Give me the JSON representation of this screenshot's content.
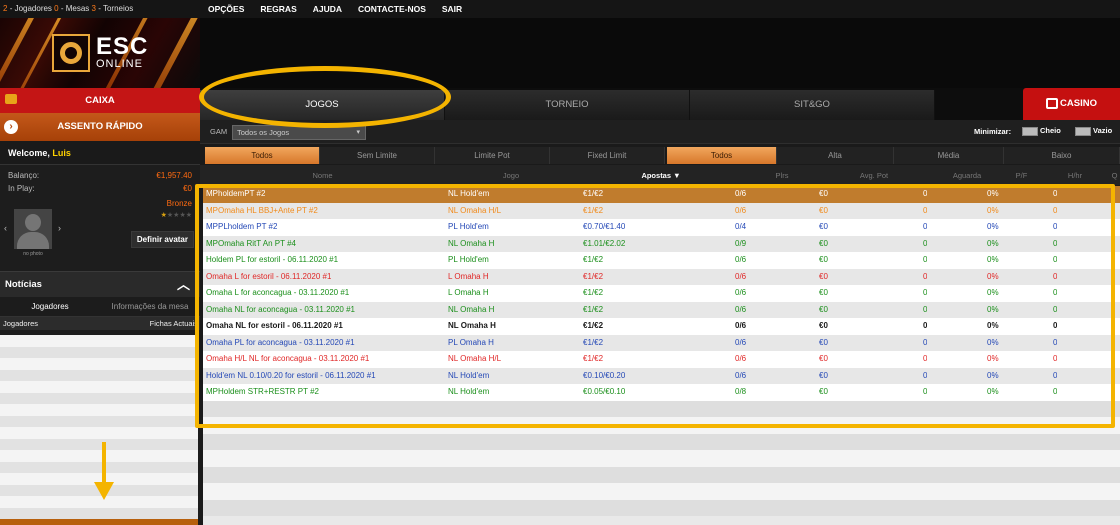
{
  "topbar": {
    "counts": [
      {
        "num": "2",
        "label": "- Jogadores"
      },
      {
        "num": "0",
        "label": "- Mesas"
      },
      {
        "num": "3",
        "label": "- Torneios"
      }
    ],
    "menu": [
      "OPÇÕES",
      "REGRAS",
      "AJUDA",
      "CONTACTE-NOS",
      "SAIR"
    ]
  },
  "logo": {
    "name": "ESC",
    "sub": "ONLINE"
  },
  "sidebar": {
    "caixa": "CAIXA",
    "assento": "ASSENTO RÁPIDO",
    "welcome_prefix": "Welcome, ",
    "user": "Luis",
    "balance_label": "Balanço:",
    "balance_value": "€1,957.40",
    "inplay_label": "In Play:",
    "inplay_value": "€0",
    "level": "Bronze",
    "stars_filled": 1,
    "stars_total": 5,
    "avatar_caption": "no photo",
    "define_avatar": "Definir avatar",
    "news": "Notícias",
    "tab_players": "Jogadores",
    "tab_info": "Informações da mesa",
    "col_players": "Jogadores",
    "col_chips": "Fichas Actuais"
  },
  "main_tabs": [
    "JOGOS",
    "TORNEIO",
    "SIT&GO"
  ],
  "casino": "CASINO",
  "filter": {
    "game_label": "GAM",
    "game_value": "Todos os Jogos",
    "minimize_label": "Minimizar:",
    "full": "Cheio",
    "empty": "Vazio",
    "limit_tabs": [
      "Todos",
      "Sem Limite",
      "Limite Pot",
      "Fixed Limit"
    ],
    "stake_tabs": [
      "Todos",
      "Alta",
      "Média",
      "Baixo"
    ]
  },
  "columns": [
    "Nome",
    "Jogo",
    "Apostas ▼",
    "Plrs",
    "Avg. Pot",
    "Aguarda",
    "P/F",
    "H/hr",
    "Q"
  ],
  "tables": [
    {
      "nome": "MPholdemPT #2",
      "jogo": "NL Hold'em",
      "apostas": "€1/€2",
      "plrs": "0/6",
      "avg": "€0",
      "aguarda": "0",
      "pf": "0%",
      "hhr": "0",
      "color": "white",
      "selected": true
    },
    {
      "nome": "MPOmaha HL BBJ+Ante PT #2",
      "jogo": "NL Omaha H/L",
      "apostas": "€1/€2",
      "plrs": "0/6",
      "avg": "€0",
      "aguarda": "0",
      "pf": "0%",
      "hhr": "0",
      "color": "orange"
    },
    {
      "nome": "MPPLholdem PT #2",
      "jogo": "PL Hold'em",
      "apostas": "€0.70/€1.40",
      "plrs": "0/4",
      "avg": "€0",
      "aguarda": "0",
      "pf": "0%",
      "hhr": "0",
      "color": "blue"
    },
    {
      "nome": "MPOmaha RitT An PT #4",
      "jogo": "NL Omaha H",
      "apostas": "€1.01/€2.02",
      "plrs": "0/9",
      "avg": "€0",
      "aguarda": "0",
      "pf": "0%",
      "hhr": "0",
      "color": "green"
    },
    {
      "nome": "Holdem PL for estoril - 06.11.2020 #1",
      "jogo": "PL Hold'em",
      "apostas": "€1/€2",
      "plrs": "0/6",
      "avg": "€0",
      "aguarda": "0",
      "pf": "0%",
      "hhr": "0",
      "color": "green"
    },
    {
      "nome": "Omaha L for estoril - 06.11.2020 #1",
      "jogo": "L Omaha H",
      "apostas": "€1/€2",
      "plrs": "0/6",
      "avg": "€0",
      "aguarda": "0",
      "pf": "0%",
      "hhr": "0",
      "color": "red"
    },
    {
      "nome": "Omaha L for aconcagua - 03.11.2020 #1",
      "jogo": "L Omaha H",
      "apostas": "€1/€2",
      "plrs": "0/6",
      "avg": "€0",
      "aguarda": "0",
      "pf": "0%",
      "hhr": "0",
      "color": "green"
    },
    {
      "nome": "Omaha NL for aconcagua - 03.11.2020 #1",
      "jogo": "NL Omaha H",
      "apostas": "€1/€2",
      "plrs": "0/6",
      "avg": "€0",
      "aguarda": "0",
      "pf": "0%",
      "hhr": "0",
      "color": "green"
    },
    {
      "nome": "Omaha NL for estoril - 06.11.2020 #1",
      "jogo": "NL Omaha H",
      "apostas": "€1/€2",
      "plrs": "0/6",
      "avg": "€0",
      "aguarda": "0",
      "pf": "0%",
      "hhr": "0",
      "color": "black"
    },
    {
      "nome": "Omaha PL for aconcagua - 03.11.2020 #1",
      "jogo": "PL Omaha H",
      "apostas": "€1/€2",
      "plrs": "0/6",
      "avg": "€0",
      "aguarda": "0",
      "pf": "0%",
      "hhr": "0",
      "color": "blue"
    },
    {
      "nome": "Omaha H/L NL for aconcagua - 03.11.2020 #1",
      "jogo": "NL Omaha H/L",
      "apostas": "€1/€2",
      "plrs": "0/6",
      "avg": "€0",
      "aguarda": "0",
      "pf": "0%",
      "hhr": "0",
      "color": "red"
    },
    {
      "nome": "Hold'em NL 0.10/0.20 for estoril - 06.11.2020 #1",
      "jogo": "NL Hold'em",
      "apostas": "€0.10/€0.20",
      "plrs": "0/6",
      "avg": "€0",
      "aguarda": "0",
      "pf": "0%",
      "hhr": "0",
      "color": "blue"
    },
    {
      "nome": "MPHoldem STR+RESTR PT #2",
      "jogo": "NL Hold'em",
      "apostas": "€0.05/€0.10",
      "plrs": "0/8",
      "avg": "€0",
      "aguarda": "0",
      "pf": "0%",
      "hhr": "0",
      "color": "green"
    }
  ]
}
